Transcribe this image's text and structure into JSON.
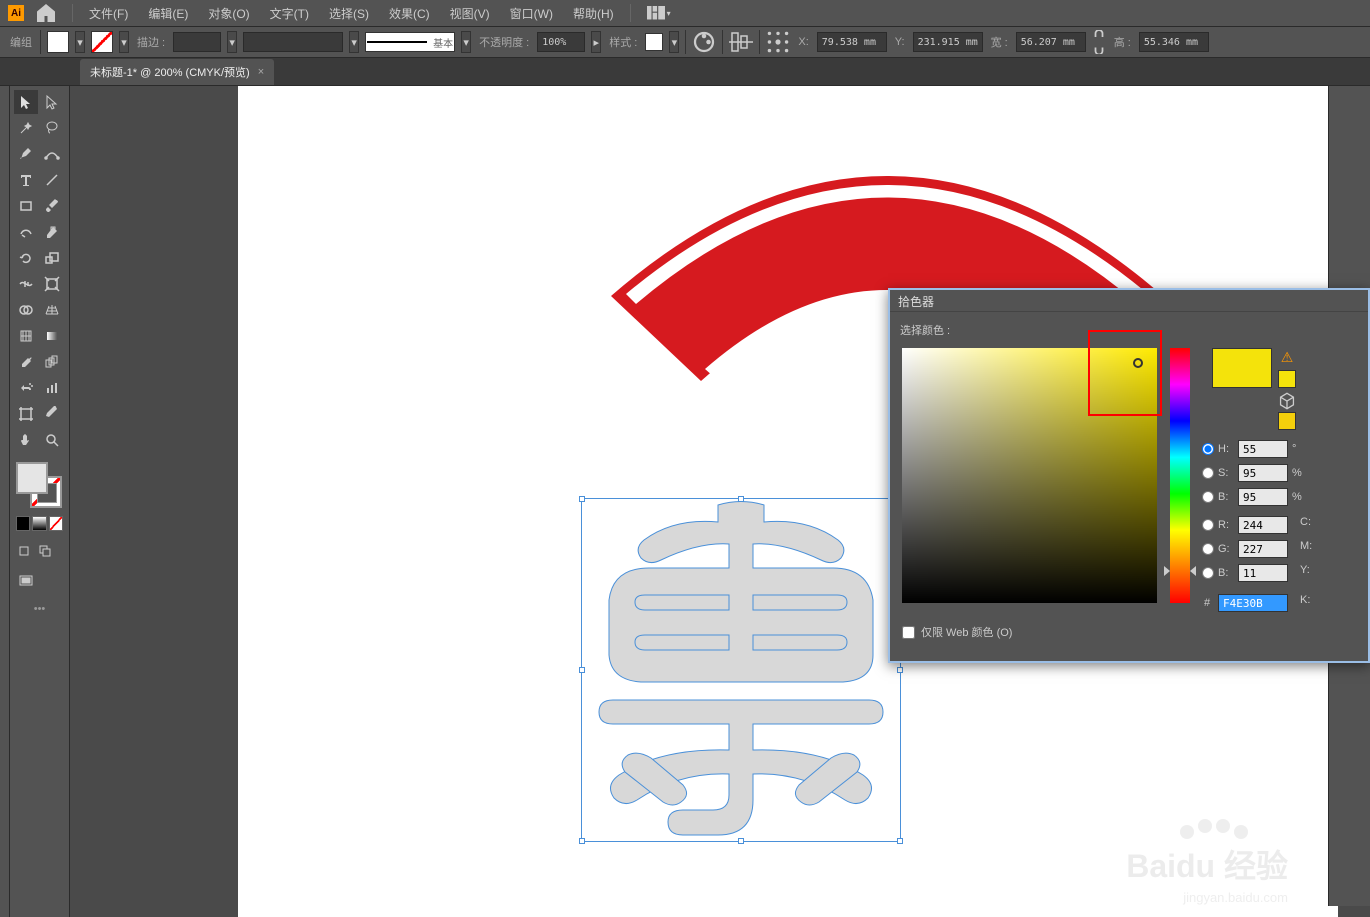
{
  "menubar": {
    "file": "文件(F)",
    "edit": "编辑(E)",
    "object": "对象(O)",
    "type": "文字(T)",
    "select": "选择(S)",
    "effect": "效果(C)",
    "view": "视图(V)",
    "window": "窗口(W)",
    "help": "帮助(H)"
  },
  "controlbar": {
    "group": "编组",
    "stroke_label": "描边 :",
    "stroke_value": "",
    "profile_label": "基本",
    "opacity_label": "不透明度 :",
    "opacity_value": "100%",
    "style_label": "样式 :",
    "x_label": "X:",
    "x_value": "79.538 mm",
    "y_label": "Y:",
    "y_value": "231.915 mm",
    "w_label": "宽 :",
    "w_value": "56.207 mm",
    "h_label": "高 :",
    "h_value": "55.346 mm"
  },
  "doctab": {
    "title": "未标题-1* @ 200% (CMYK/预览)",
    "close": "×"
  },
  "picker": {
    "title": "拾色器",
    "select_label": "选择颜色 :",
    "h": {
      "label": "H:",
      "value": "55",
      "unit": "°"
    },
    "s": {
      "label": "S:",
      "value": "95",
      "unit": "%"
    },
    "b": {
      "label": "B:",
      "value": "95",
      "unit": "%"
    },
    "r": {
      "label": "R:",
      "value": "244"
    },
    "g": {
      "label": "G:",
      "value": "227"
    },
    "bb": {
      "label": "B:",
      "value": "11"
    },
    "hex_label": "#",
    "hex_value": "F4E30B",
    "c": "C:",
    "m": "M:",
    "y": "Y:",
    "k": "K:",
    "webonly": "仅限 Web 颜色 (O)"
  },
  "watermark": {
    "main": "Baidu 经验",
    "sub": "jingyan.baidu.com"
  }
}
